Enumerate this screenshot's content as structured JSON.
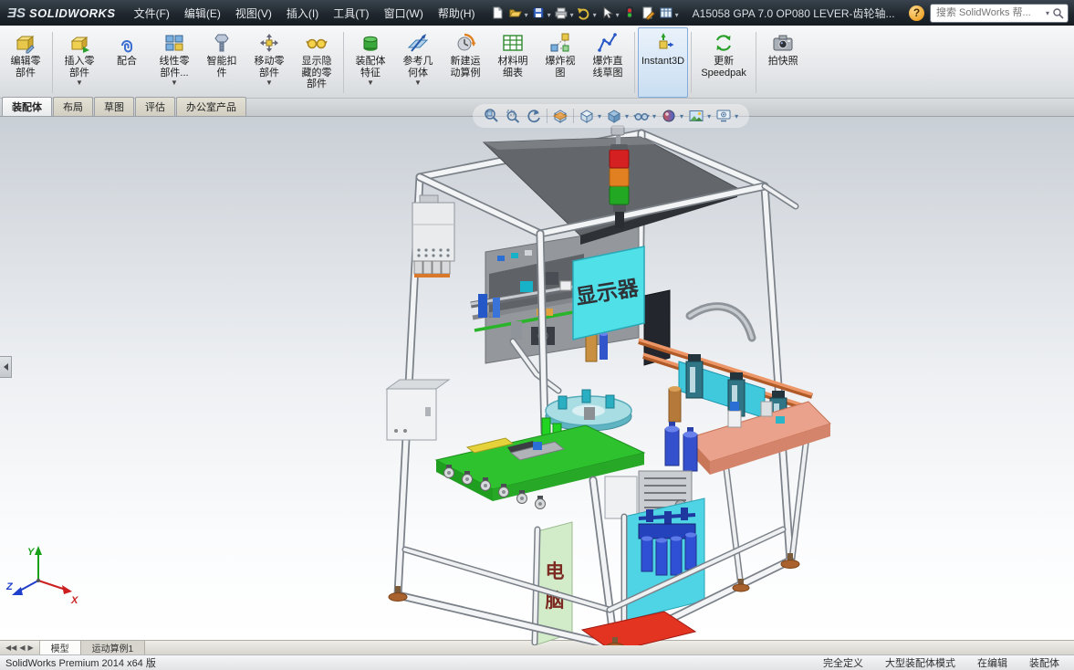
{
  "title_bar": {
    "logo_mark": "ƎS",
    "logo_text": "SOLIDWORKS",
    "menus": [
      "文件(F)",
      "编辑(E)",
      "视图(V)",
      "插入(I)",
      "工具(T)",
      "窗口(W)",
      "帮助(H)"
    ],
    "tool_icons": [
      "new-document",
      "open",
      "save",
      "print",
      "undo",
      "select",
      "rebuild",
      "file-properties",
      "display-settings"
    ],
    "document_title": "A15058 GPA 7.0 OP080 LEVER-齿轮轴...",
    "help_label": "?",
    "search": {
      "placeholder": "搜索 SolidWorks 帮..."
    }
  },
  "ribbon": {
    "buttons": [
      {
        "label": "编辑零部件",
        "icon": "edit-component"
      },
      {
        "label": "插入零部件",
        "icon": "insert-component",
        "dropdown": true
      },
      {
        "label": "配合",
        "icon": "mate"
      },
      {
        "label": "线性零部件...",
        "icon": "linear-component-pattern",
        "dropdown": true
      },
      {
        "label": "智能扣件",
        "icon": "smart-fasteners"
      },
      {
        "label": "移动零部件",
        "icon": "move-component",
        "dropdown": true
      },
      {
        "label": "显示隐藏的零部件",
        "icon": "show-hidden-components"
      },
      {
        "label": "装配体特征",
        "icon": "assembly-features",
        "dropdown": true
      },
      {
        "label": "参考几何体",
        "icon": "reference-geometry",
        "dropdown": true
      },
      {
        "label": "新建运动算例",
        "icon": "new-motion-study"
      },
      {
        "label": "材料明细表",
        "icon": "bill-of-materials"
      },
      {
        "label": "爆炸视图",
        "icon": "exploded-view"
      },
      {
        "label": "爆炸直线草图",
        "icon": "explode-line-sketch"
      },
      {
        "label": "Instant3D",
        "icon": "instant3d",
        "active": true
      },
      {
        "label": "更新Speedpak",
        "icon": "update-speedpak"
      },
      {
        "label": "拍快照",
        "icon": "take-snapshot"
      }
    ]
  },
  "command_tabs": [
    {
      "label": "装配体",
      "active": true
    },
    {
      "label": "布局"
    },
    {
      "label": "草图"
    },
    {
      "label": "评估"
    },
    {
      "label": "办公室产品"
    }
  ],
  "hud": {
    "icons": [
      "zoom-to-fit",
      "zoom-to-area",
      "previous-view",
      "section-view",
      "view-orientation",
      "display-style",
      "hide-show-items",
      "edit-appearance",
      "apply-scene",
      "view-settings"
    ]
  },
  "viewport": {
    "model_labels": {
      "monitor": "显示器",
      "computer_top": "电",
      "computer_bottom": "脑"
    },
    "triad": {
      "x": "X",
      "y": "Y",
      "z": "Z"
    }
  },
  "doc_tabs": [
    {
      "label": "模型",
      "active": true
    },
    {
      "label": "运动算例1"
    }
  ],
  "status_bar": {
    "left": "SolidWorks Premium 2014 x64 版",
    "items": [
      "完全定义",
      "大型装配体模式",
      "在编辑",
      "装配体"
    ]
  },
  "colors": {
    "monitor_panel": "#50e0e8",
    "table_green": "#2ec22e",
    "conveyor_salmon": "#e8946a",
    "alarm_red": "#d42020",
    "alarm_amber": "#e08020",
    "alarm_green": "#22a822"
  }
}
